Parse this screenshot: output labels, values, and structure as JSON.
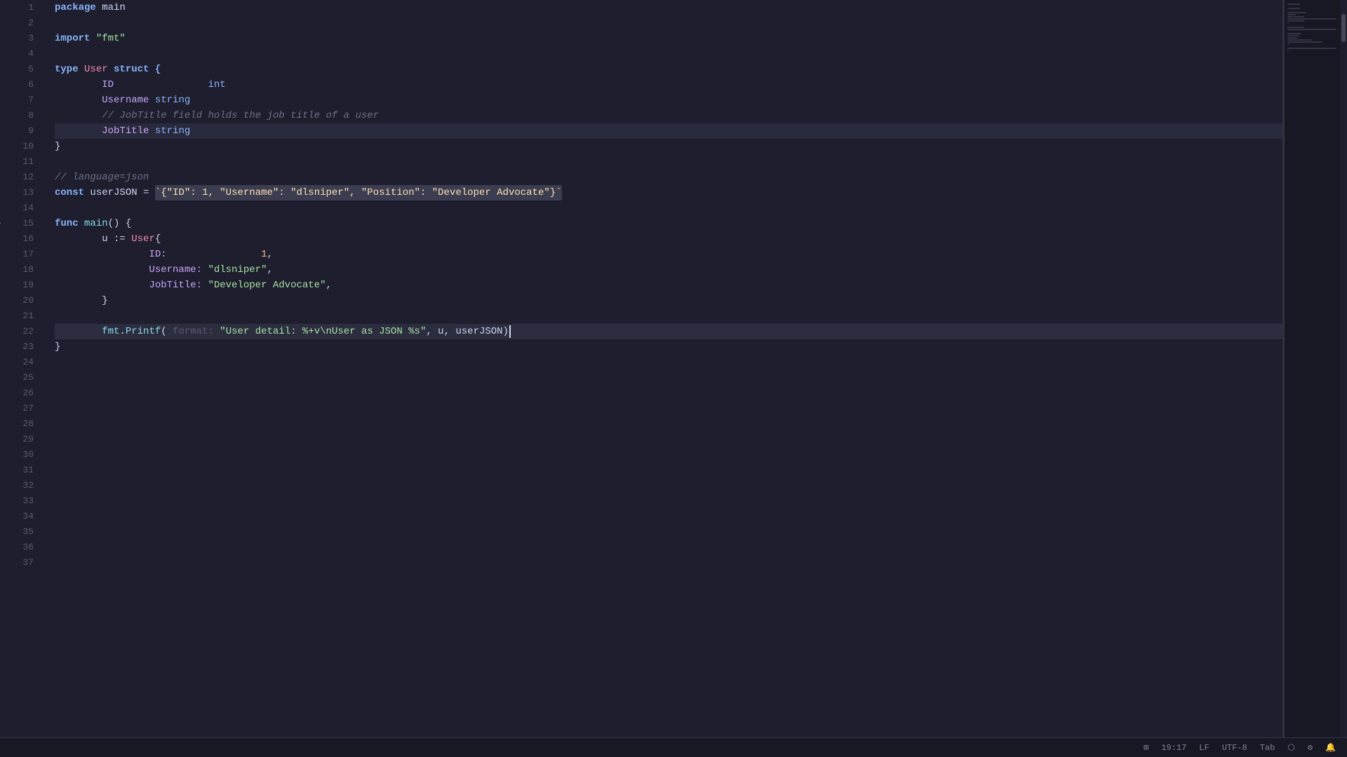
{
  "editor": {
    "lines": [
      {
        "num": 1,
        "tokens": [
          {
            "text": "package",
            "cls": "kw-package"
          },
          {
            "text": " main",
            "cls": "var-name"
          }
        ]
      },
      {
        "num": 2,
        "tokens": []
      },
      {
        "num": 3,
        "tokens": [
          {
            "text": "import",
            "cls": "kw-import"
          },
          {
            "text": " ",
            "cls": ""
          },
          {
            "text": "\"fmt\"",
            "cls": "string"
          }
        ]
      },
      {
        "num": 4,
        "tokens": []
      },
      {
        "num": 5,
        "tokens": [
          {
            "text": "type",
            "cls": "kw-type"
          },
          {
            "text": " ",
            "cls": ""
          },
          {
            "text": "User",
            "cls": "type-name"
          },
          {
            "text": " struct {",
            "cls": "kw-struct"
          }
        ],
        "fold": true,
        "foldOpen": true
      },
      {
        "num": 6,
        "tokens": [
          {
            "text": "\t",
            "cls": ""
          },
          {
            "text": "ID",
            "cls": "field-name"
          },
          {
            "text": "\t\t",
            "cls": ""
          },
          {
            "text": "int",
            "cls": "type-hint"
          }
        ]
      },
      {
        "num": 7,
        "tokens": [
          {
            "text": "\t",
            "cls": ""
          },
          {
            "text": "Username",
            "cls": "field-name"
          },
          {
            "text": " ",
            "cls": ""
          },
          {
            "text": "string",
            "cls": "type-hint"
          }
        ]
      },
      {
        "num": 8,
        "tokens": [
          {
            "text": "\t",
            "cls": ""
          },
          {
            "text": "// JobTitle field holds the job title of a user",
            "cls": "comment"
          }
        ]
      },
      {
        "num": 9,
        "tokens": [
          {
            "text": "\t",
            "cls": ""
          },
          {
            "text": "JobTitle",
            "cls": "field-name"
          },
          {
            "text": " ",
            "cls": ""
          },
          {
            "text": "string",
            "cls": "type-hint"
          }
        ],
        "highlighted": true
      },
      {
        "num": 10,
        "tokens": [
          {
            "text": "}",
            "cls": "var-name"
          }
        ],
        "foldClose": true
      },
      {
        "num": 11,
        "tokens": []
      },
      {
        "num": 12,
        "tokens": [
          {
            "text": "// language=json",
            "cls": "comment"
          }
        ]
      },
      {
        "num": 13,
        "tokens": [
          {
            "text": "const",
            "cls": "kw-const"
          },
          {
            "text": " ",
            "cls": ""
          },
          {
            "text": "userJSON",
            "cls": "var-name"
          },
          {
            "text": " = ",
            "cls": "operator"
          },
          {
            "text": "`{\"ID\": 1, \"Username\": \"dlsniper\", \"Position\": \"Developer Advocate\"}`",
            "cls": "highlighted-json json-key"
          }
        ]
      },
      {
        "num": 14,
        "tokens": []
      },
      {
        "num": 15,
        "tokens": [
          {
            "text": "func",
            "cls": "kw-func"
          },
          {
            "text": " ",
            "cls": ""
          },
          {
            "text": "main",
            "cls": "func-name"
          },
          {
            "text": "() {",
            "cls": "var-name"
          }
        ],
        "fold": true,
        "foldOpen": true,
        "runnable": true
      },
      {
        "num": 16,
        "tokens": [
          {
            "text": "\t",
            "cls": ""
          },
          {
            "text": "u",
            "cls": "var-name"
          },
          {
            "text": " := ",
            "cls": "operator"
          },
          {
            "text": "User",
            "cls": "type-name"
          },
          {
            "text": "{",
            "cls": "var-name"
          }
        ],
        "fold": true,
        "foldOpen": true
      },
      {
        "num": 17,
        "tokens": [
          {
            "text": "\t\t",
            "cls": ""
          },
          {
            "text": "ID:",
            "cls": "field-name"
          },
          {
            "text": "\t\t",
            "cls": ""
          },
          {
            "text": "1",
            "cls": "number"
          },
          {
            "text": ",",
            "cls": "var-name"
          }
        ]
      },
      {
        "num": 18,
        "tokens": [
          {
            "text": "\t\t",
            "cls": ""
          },
          {
            "text": "Username:",
            "cls": "field-name"
          },
          {
            "text": " ",
            "cls": ""
          },
          {
            "text": "\"dlsniper\"",
            "cls": "string"
          },
          {
            "text": ",",
            "cls": "var-name"
          }
        ]
      },
      {
        "num": 19,
        "tokens": [
          {
            "text": "\t\t",
            "cls": ""
          },
          {
            "text": "JobTitle:",
            "cls": "field-name"
          },
          {
            "text": " ",
            "cls": ""
          },
          {
            "text": "\"Developer Advocate\"",
            "cls": "string"
          },
          {
            "text": ",",
            "cls": "var-name"
          }
        ]
      },
      {
        "num": 20,
        "tokens": [
          {
            "text": "\t",
            "cls": ""
          },
          {
            "text": "}",
            "cls": "var-name"
          }
        ],
        "foldClose": true
      },
      {
        "num": 21,
        "tokens": []
      },
      {
        "num": 22,
        "tokens": [
          {
            "text": "\t",
            "cls": ""
          },
          {
            "text": "fmt",
            "cls": "pkg-name"
          },
          {
            "text": ".",
            "cls": "var-name"
          },
          {
            "text": "Printf",
            "cls": "func-name"
          },
          {
            "text": "( ",
            "cls": "var-name"
          },
          {
            "text": "format:",
            "cls": "param-hint"
          },
          {
            "text": " ",
            "cls": ""
          },
          {
            "text": "\"User detail: %+v\\nUser as JSON %s\"",
            "cls": "format-str"
          },
          {
            "text": ", u, ",
            "cls": "var-name"
          },
          {
            "text": "userJSON",
            "cls": "var-name"
          },
          {
            "text": ")",
            "cls": "var-name"
          }
        ],
        "activeCursor": true
      },
      {
        "num": 23,
        "tokens": [
          {
            "text": "}",
            "cls": "var-name"
          }
        ],
        "foldClose": true
      },
      {
        "num": 24,
        "tokens": []
      },
      {
        "num": 25,
        "tokens": []
      },
      {
        "num": 26,
        "tokens": []
      },
      {
        "num": 27,
        "tokens": []
      },
      {
        "num": 28,
        "tokens": []
      },
      {
        "num": 29,
        "tokens": []
      },
      {
        "num": 30,
        "tokens": []
      },
      {
        "num": 31,
        "tokens": []
      },
      {
        "num": 32,
        "tokens": []
      },
      {
        "num": 33,
        "tokens": []
      },
      {
        "num": 34,
        "tokens": []
      },
      {
        "num": 35,
        "tokens": []
      },
      {
        "num": 36,
        "tokens": []
      },
      {
        "num": 37,
        "tokens": []
      }
    ]
  },
  "statusBar": {
    "position": "19:17",
    "lineEnding": "LF",
    "encoding": "UTF-8",
    "indentation": "Tab",
    "tabSize": "",
    "icons": [
      "layout-icon",
      "save-icon",
      "settings-icon",
      "extensions-icon",
      "notifications-icon"
    ]
  },
  "detection": {
    "of_text": "of",
    "type_text": "type"
  }
}
